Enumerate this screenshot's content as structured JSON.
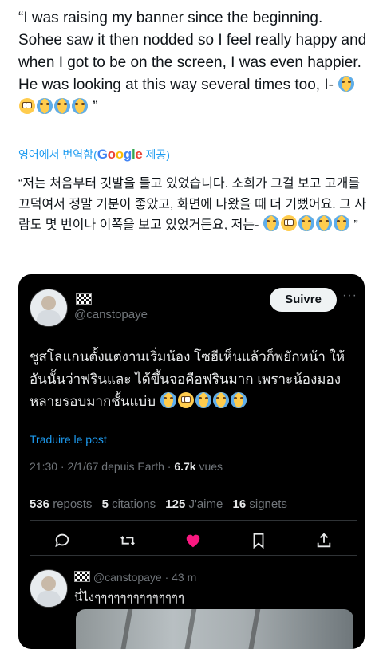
{
  "tweet": {
    "text_en": "“I was raising my banner since the beginning. Sohee saw it then nodded so I feel really happy and when I got to be on the screen, I was even happier. He was looking at this way several times too, I-",
    "text_en_end": "”",
    "emojis_en": [
      "loudly-crying-face",
      "pleading-face",
      "loudly-crying-face",
      "loudly-crying-face",
      "loudly-crying-face"
    ],
    "translated_from": "영어에서 번역함",
    "translated_by_suffix": "제공)",
    "google": "Google",
    "text_ko": "“저는 처음부터 깃발을 들고 있었습니다. 소희가 그걸 보고 고개를 끄덕여서 정말 기분이 좋았고, 화면에 나왔을 때 더 기뻤어요. 그 사람도 몇 번이나 이쪽을 보고 있었거든요, 저는-",
    "text_ko_end": "”",
    "emojis_ko": [
      "loudly-crying-face",
      "pleading-face",
      "loudly-crying-face",
      "loudly-crying-face",
      "loudly-crying-face"
    ]
  },
  "embedded": {
    "handle": "@canstopaye",
    "follow_label": "Suivre",
    "more": "···",
    "text_th": "ชูสโลแกนตั้งแต่งานเริ่มน้อง โซฮีเห็นแล้วก็พยักหน้า ให้อันนั้นว่าฟรินและ ได้ขึ้นจอคือฟรินมาก เพราะน้องมองหลายรอบมากชั้นแบ่บ",
    "emojis_th": [
      "loudly-crying-face",
      "pleading-face",
      "loudly-crying-face",
      "loudly-crying-face",
      "loudly-crying-face"
    ],
    "translate_label": "Traduire le post",
    "meta": "21:30 · 2/1/67 depuis Earth · ",
    "views_count": "6.7k",
    "views_label": " vues",
    "stats": [
      {
        "count": "536",
        "label": " reposts"
      },
      {
        "count": "5",
        "label": " citations"
      },
      {
        "count": "125",
        "label": " J'aime"
      },
      {
        "count": "16",
        "label": " signets"
      }
    ],
    "accent_like": "#f91880",
    "reply": {
      "handle": "@canstopaye · 43 m",
      "text": "นี่ไงๆๆๆๆๆๆๆๆๆๆๆๆๆๆ"
    }
  }
}
